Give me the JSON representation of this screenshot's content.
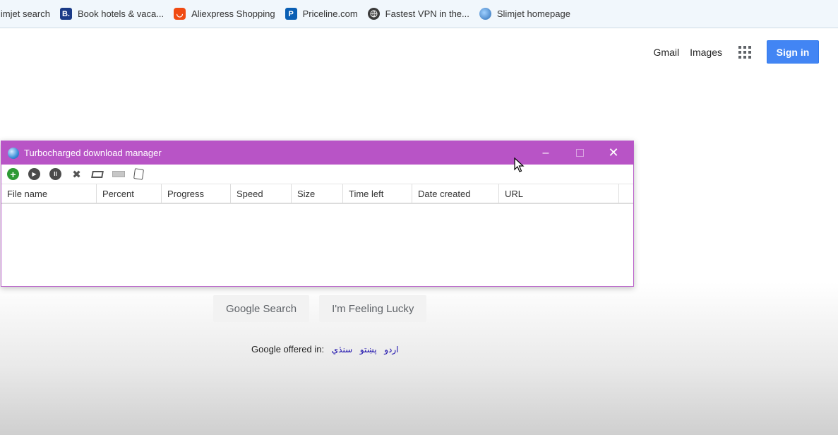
{
  "bookmarks": [
    {
      "label": "limjet search",
      "icon": "none"
    },
    {
      "label": "Book hotels & vaca...",
      "icon": "booking-icon",
      "glyph": "B."
    },
    {
      "label": "Aliexpress Shopping",
      "icon": "aliexpress-icon",
      "glyph": "◡"
    },
    {
      "label": "Priceline.com",
      "icon": "priceline-icon",
      "glyph": "P"
    },
    {
      "label": "Fastest VPN in the...",
      "icon": "globe-icon",
      "glyph": ""
    },
    {
      "label": "Slimjet homepage",
      "icon": "slimjet-icon",
      "glyph": ""
    }
  ],
  "google": {
    "gmail": "Gmail",
    "images": "Images",
    "signin": "Sign in",
    "search_btn": "Google Search",
    "lucky_btn": "I'm Feeling Lucky",
    "offered_label": "Google offered in:",
    "languages": [
      "اردو",
      "پښتو",
      "سنڌي"
    ]
  },
  "download_manager": {
    "title": "Turbocharged download manager",
    "controls": {
      "minimize": "–",
      "close": "✕"
    },
    "toolbar": [
      {
        "name": "add-download-icon",
        "glyph": "+"
      },
      {
        "name": "resume-icon",
        "glyph": "▶"
      },
      {
        "name": "pause-icon",
        "glyph": "II"
      },
      {
        "name": "remove-icon",
        "glyph": "✖"
      },
      {
        "name": "open-folder-icon",
        "glyph": ""
      },
      {
        "name": "progress-bar-icon",
        "glyph": ""
      },
      {
        "name": "edit-icon",
        "glyph": ""
      }
    ],
    "columns": [
      "File name",
      "Percent",
      "Progress",
      "Speed",
      "Size",
      "Time left",
      "Date created",
      "URL"
    ]
  },
  "colors": {
    "window_accent": "#b854c6",
    "signin_blue": "#4285f4"
  }
}
